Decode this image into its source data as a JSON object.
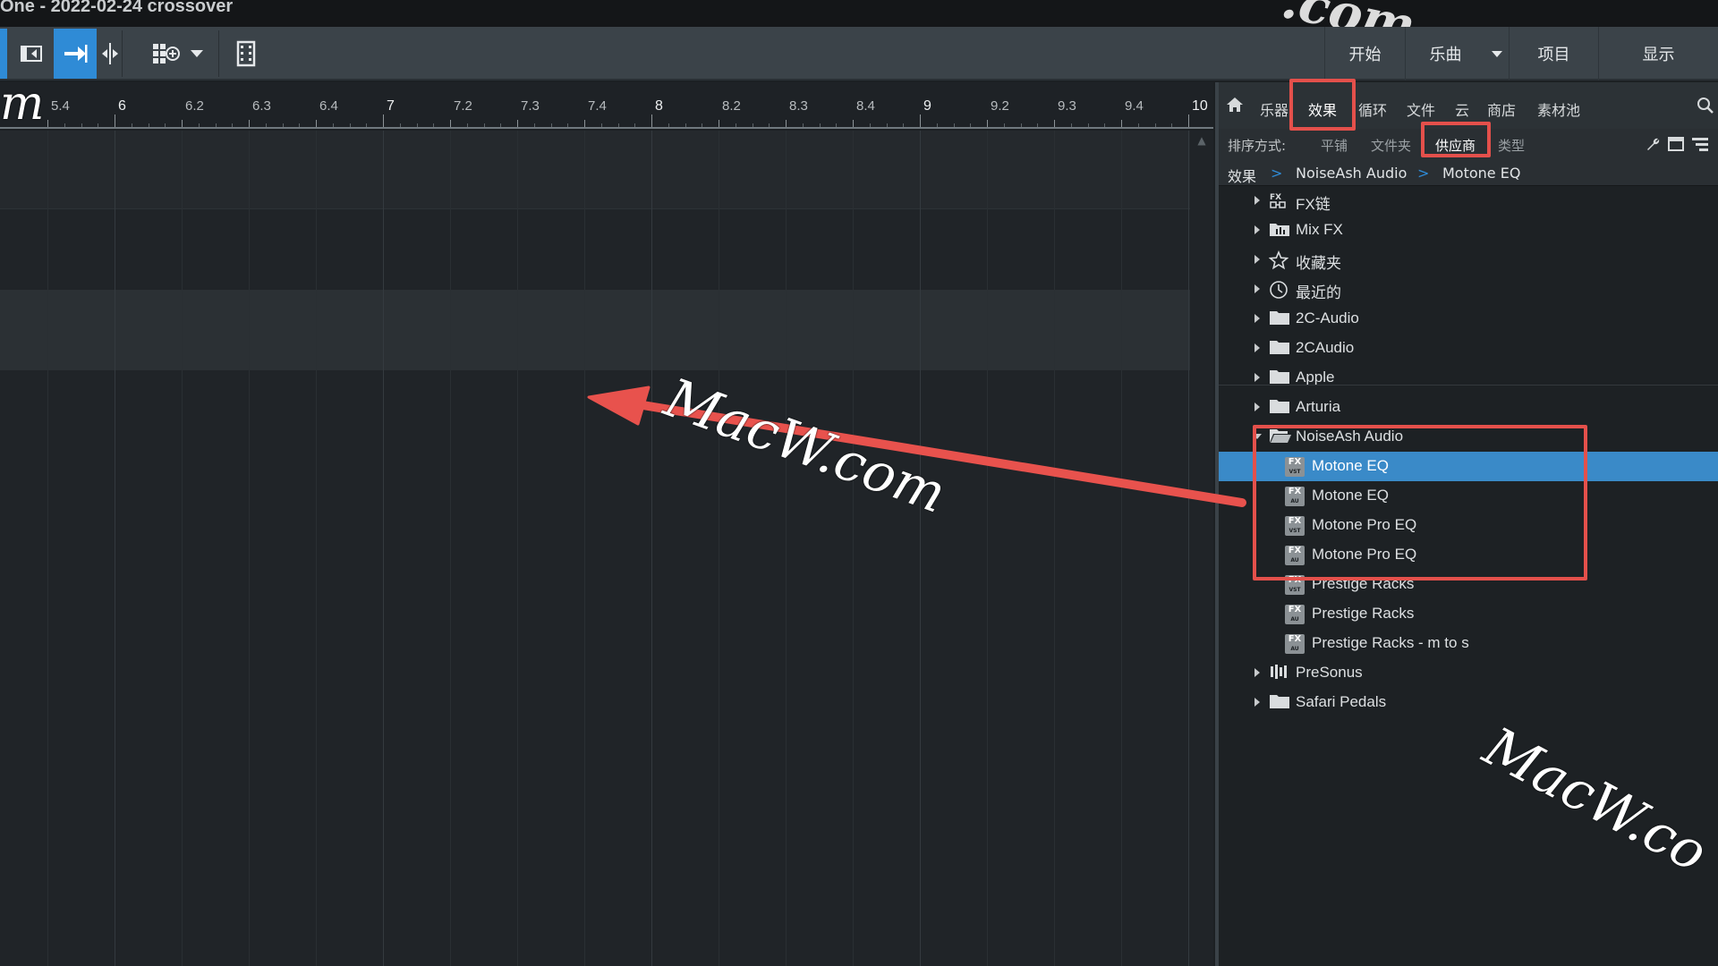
{
  "window": {
    "title": "One - 2022-02-24 crossover"
  },
  "watermark": {
    "text_main": "MacW.com",
    "text_top": ".com",
    "text_right": "MacW.co",
    "text_left": "m"
  },
  "toolbar": {
    "icons": [
      "scroll-left-icon",
      "loop-marker-icon",
      "follow-arrow-icon",
      "split-icon",
      "grid-add-icon",
      "dropdown-caret-icon",
      "film-icon"
    ],
    "nav": {
      "start": "开始",
      "song": "乐曲",
      "project": "项目",
      "show": "显示"
    }
  },
  "ruler": {
    "ticks": [
      {
        "label": "5.4",
        "major": false
      },
      {
        "label": "6",
        "major": true
      },
      {
        "label": "6.2",
        "major": false
      },
      {
        "label": "6.3",
        "major": false
      },
      {
        "label": "6.4",
        "major": false
      },
      {
        "label": "7",
        "major": true
      },
      {
        "label": "7.2",
        "major": false
      },
      {
        "label": "7.3",
        "major": false
      },
      {
        "label": "7.4",
        "major": false
      },
      {
        "label": "8",
        "major": true
      },
      {
        "label": "8.2",
        "major": false
      },
      {
        "label": "8.3",
        "major": false
      },
      {
        "label": "8.4",
        "major": false
      },
      {
        "label": "9",
        "major": true
      },
      {
        "label": "9.2",
        "major": false
      },
      {
        "label": "9.3",
        "major": false
      },
      {
        "label": "9.4",
        "major": false
      },
      {
        "label": "10",
        "major": true
      }
    ]
  },
  "browser": {
    "tabs": {
      "instruments": "乐器",
      "effects": "效果",
      "loops": "循环",
      "files": "文件",
      "cloud": "云",
      "shop": "商店",
      "pool": "素材池"
    },
    "sort": {
      "label": "排序方式:",
      "flat": "平铺",
      "folder": "文件夹",
      "vendor": "供应商",
      "type": "类型"
    },
    "breadcrumb": {
      "root": "效果",
      "sep": ">",
      "vendor": "NoiseAsh Audio",
      "item": "Motone EQ"
    },
    "tree": [
      {
        "label": "FX链",
        "icon": "fx-chain-icon",
        "kind": "top"
      },
      {
        "label": "Mix FX",
        "icon": "mixfx-icon",
        "kind": "top"
      },
      {
        "label": "收藏夹",
        "icon": "star-icon",
        "kind": "top"
      },
      {
        "label": "最近的",
        "icon": "clock-icon",
        "kind": "top"
      },
      {
        "label": "2C-Audio",
        "icon": "folder-icon",
        "kind": "folder"
      },
      {
        "label": "2CAudio",
        "icon": "folder-icon",
        "kind": "folder"
      },
      {
        "label": "Apple",
        "icon": "folder-icon",
        "kind": "folder"
      },
      {
        "label": "Arturia",
        "icon": "folder-icon",
        "kind": "folder"
      },
      {
        "label": "NoiseAsh Audio",
        "icon": "folder-open-icon",
        "kind": "open"
      },
      {
        "label": "Motone EQ",
        "icon": "fx-vst-icon",
        "kind": "plugin",
        "badge": "FX",
        "sub": "VST",
        "selected": true
      },
      {
        "label": "Motone EQ",
        "icon": "fx-au-icon",
        "kind": "plugin",
        "badge": "FX",
        "sub": "AU"
      },
      {
        "label": "Motone Pro EQ",
        "icon": "fx-vst-icon",
        "kind": "plugin",
        "badge": "FX",
        "sub": "VST"
      },
      {
        "label": "Motone Pro EQ",
        "icon": "fx-au-icon",
        "kind": "plugin",
        "badge": "FX",
        "sub": "AU"
      },
      {
        "label": "Prestige Racks",
        "icon": "fx-vst-icon",
        "kind": "plugin",
        "badge": "FX",
        "sub": "VST"
      },
      {
        "label": "Prestige Racks",
        "icon": "fx-au-icon",
        "kind": "plugin",
        "badge": "FX",
        "sub": "AU"
      },
      {
        "label": "Prestige Racks - m to s",
        "icon": "fx-au-icon",
        "kind": "plugin",
        "badge": "FX",
        "sub": "AU"
      },
      {
        "label": "PreSonus",
        "icon": "presonus-icon",
        "kind": "folder"
      },
      {
        "label": "Safari Pedals",
        "icon": "folder-icon",
        "kind": "folder"
      }
    ]
  },
  "colors": {
    "accent": "#2f8bd6",
    "selection": "#3a8ac8",
    "highlight": "#e4504b",
    "arrow": "#e8524d"
  }
}
